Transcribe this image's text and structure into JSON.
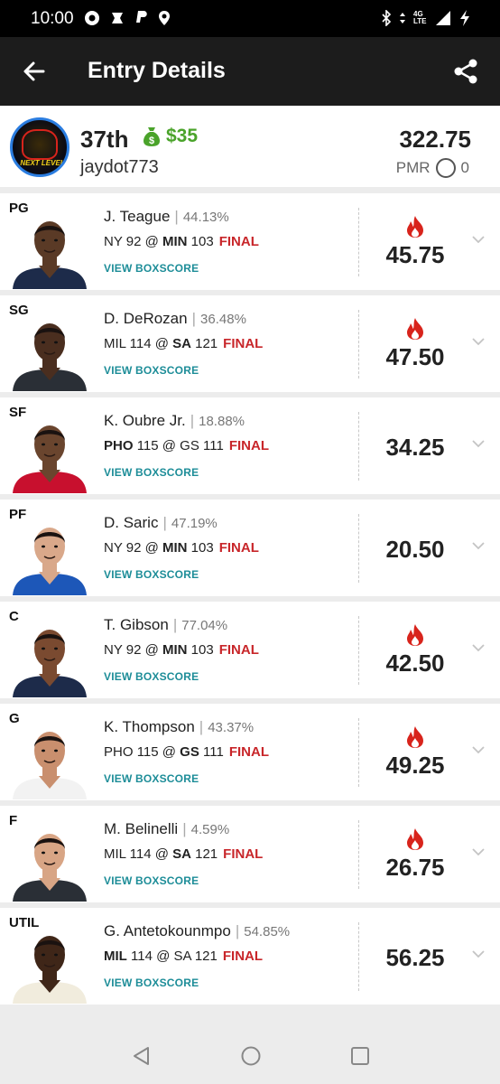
{
  "status_bar": {
    "time": "10:00",
    "network": "4G\nLTE"
  },
  "app_bar": {
    "title": "Entry Details"
  },
  "summary": {
    "avatar_text": "NEXT LEVEL",
    "rank": "37th",
    "prize": "$35",
    "username": "jaydot773",
    "total": "322.75",
    "pmr_label": "PMR",
    "pmr_value": "0"
  },
  "players": [
    {
      "pos": "PG",
      "name": "J. Teague",
      "pct": "44.13%",
      "away": "NY",
      "away_score": "92",
      "home": "MIN",
      "home_score": "103",
      "bold": "home",
      "status": "FINAL",
      "boxscore": "VIEW BOXSCORE",
      "points": "45.75",
      "fire": true,
      "jersey": "#1d2b4a",
      "skin": "#5a3a26"
    },
    {
      "pos": "SG",
      "name": "D. DeRozan",
      "pct": "36.48%",
      "away": "MIL",
      "away_score": "114",
      "home": "SA",
      "home_score": "121",
      "bold": "home",
      "status": "FINAL",
      "boxscore": "VIEW BOXSCORE",
      "points": "47.50",
      "fire": true,
      "jersey": "#2a2f36",
      "skin": "#4a2e1f"
    },
    {
      "pos": "SF",
      "name": "K. Oubre Jr.",
      "pct": "18.88%",
      "away": "PHO",
      "away_score": "115",
      "home": "GS",
      "home_score": "111",
      "bold": "away",
      "status": "FINAL",
      "boxscore": "VIEW BOXSCORE",
      "points": "34.25",
      "fire": false,
      "jersey": "#c8102e",
      "skin": "#6a452e"
    },
    {
      "pos": "PF",
      "name": "D. Saric",
      "pct": "47.19%",
      "away": "NY",
      "away_score": "92",
      "home": "MIN",
      "home_score": "103",
      "bold": "home",
      "status": "FINAL",
      "boxscore": "VIEW BOXSCORE",
      "points": "20.50",
      "fire": false,
      "jersey": "#1d57b8",
      "skin": "#d9a88a"
    },
    {
      "pos": "C",
      "name": "T. Gibson",
      "pct": "77.04%",
      "away": "NY",
      "away_score": "92",
      "home": "MIN",
      "home_score": "103",
      "bold": "home",
      "status": "FINAL",
      "boxscore": "VIEW BOXSCORE",
      "points": "42.50",
      "fire": true,
      "jersey": "#1d2b4a",
      "skin": "#7a4a30"
    },
    {
      "pos": "G",
      "name": "K. Thompson",
      "pct": "43.37%",
      "away": "PHO",
      "away_score": "115",
      "home": "GS",
      "home_score": "111",
      "bold": "home",
      "status": "FINAL",
      "boxscore": "VIEW BOXSCORE",
      "points": "49.25",
      "fire": true,
      "jersey": "#f2f2f2",
      "skin": "#c98f6e"
    },
    {
      "pos": "F",
      "name": "M. Belinelli",
      "pct": "4.59%",
      "away": "MIL",
      "away_score": "114",
      "home": "SA",
      "home_score": "121",
      "bold": "home",
      "status": "FINAL",
      "boxscore": "VIEW BOXSCORE",
      "points": "26.75",
      "fire": true,
      "jersey": "#2a2f36",
      "skin": "#d8a585"
    },
    {
      "pos": "UTIL",
      "name": "G. Antetokounmpo",
      "pct": "54.85%",
      "away": "MIL",
      "away_score": "114",
      "home": "SA",
      "home_score": "121",
      "bold": "away",
      "status": "FINAL",
      "boxscore": "VIEW BOXSCORE",
      "points": "56.25",
      "fire": false,
      "jersey": "#f1ecdd",
      "skin": "#3f2618"
    }
  ]
}
